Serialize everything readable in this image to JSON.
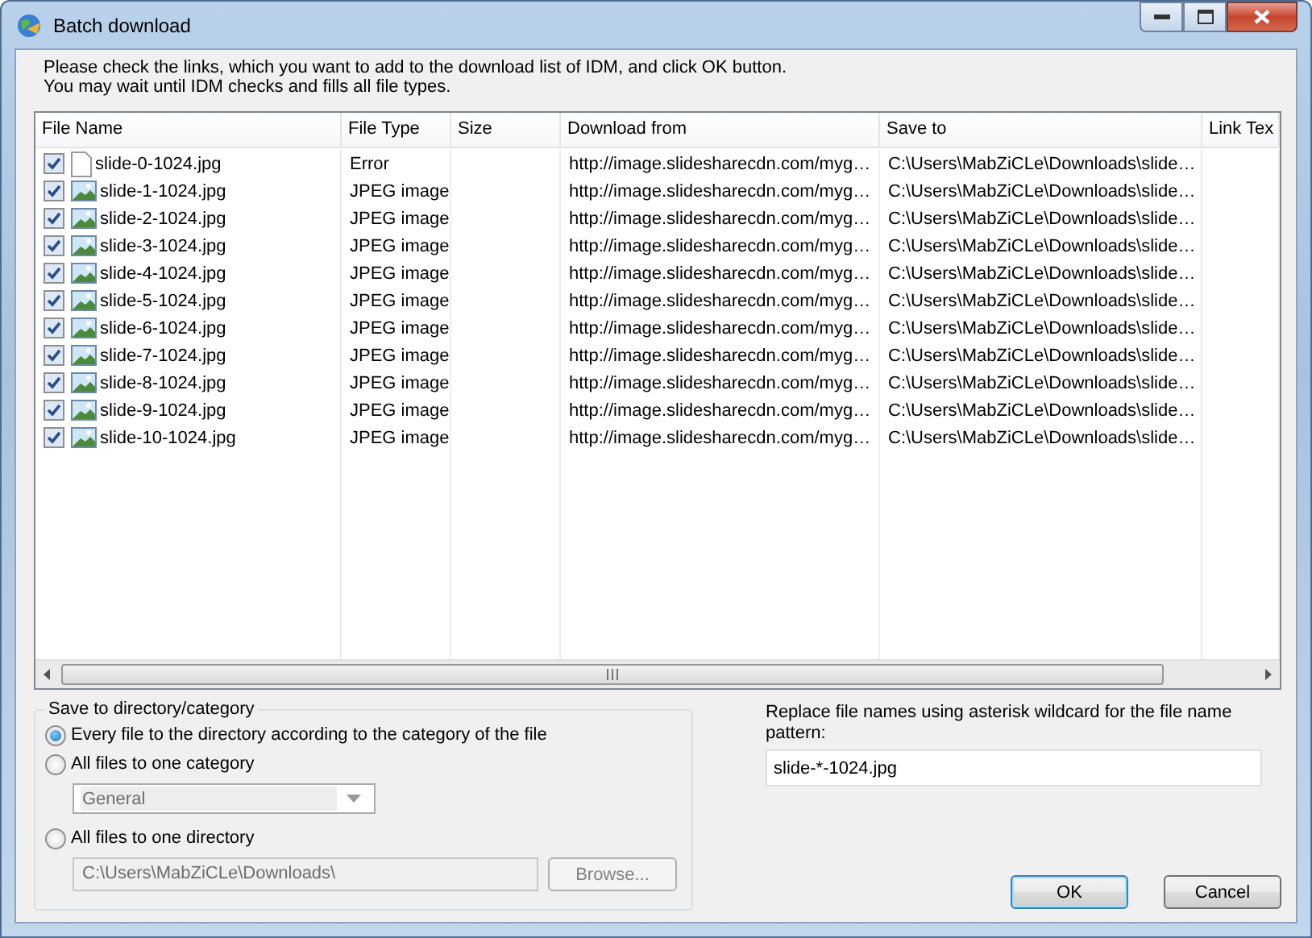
{
  "window": {
    "title": "Batch download"
  },
  "instructions": [
    "Please check the links, which you want to add to the download list of IDM, and click OK button.",
    "You may wait until IDM checks and fills all file types."
  ],
  "table": {
    "columns": [
      "File Name",
      "File Type",
      "Size",
      "Download from",
      "Save to",
      "Link Tex"
    ],
    "rows": [
      {
        "kind": "error",
        "checked": true,
        "name": "slide-0-1024.jpg",
        "type": "Error",
        "from": "http://image.slidesharecdn.com/myg…",
        "to": "C:\\Users\\MabZiCLe\\Downloads\\slide…"
      },
      {
        "kind": "image",
        "checked": true,
        "name": "slide-1-1024.jpg",
        "type": "JPEG image",
        "from": "http://image.slidesharecdn.com/myg…",
        "to": "C:\\Users\\MabZiCLe\\Downloads\\slide…"
      },
      {
        "kind": "image",
        "checked": true,
        "name": "slide-2-1024.jpg",
        "type": "JPEG image",
        "from": "http://image.slidesharecdn.com/myg…",
        "to": "C:\\Users\\MabZiCLe\\Downloads\\slide…"
      },
      {
        "kind": "image",
        "checked": true,
        "name": "slide-3-1024.jpg",
        "type": "JPEG image",
        "from": "http://image.slidesharecdn.com/myg…",
        "to": "C:\\Users\\MabZiCLe\\Downloads\\slide…"
      },
      {
        "kind": "image",
        "checked": true,
        "name": "slide-4-1024.jpg",
        "type": "JPEG image",
        "from": "http://image.slidesharecdn.com/myg…",
        "to": "C:\\Users\\MabZiCLe\\Downloads\\slide…"
      },
      {
        "kind": "image",
        "checked": true,
        "name": "slide-5-1024.jpg",
        "type": "JPEG image",
        "from": "http://image.slidesharecdn.com/myg…",
        "to": "C:\\Users\\MabZiCLe\\Downloads\\slide…"
      },
      {
        "kind": "image",
        "checked": true,
        "name": "slide-6-1024.jpg",
        "type": "JPEG image",
        "from": "http://image.slidesharecdn.com/myg…",
        "to": "C:\\Users\\MabZiCLe\\Downloads\\slide…"
      },
      {
        "kind": "image",
        "checked": true,
        "name": "slide-7-1024.jpg",
        "type": "JPEG image",
        "from": "http://image.slidesharecdn.com/myg…",
        "to": "C:\\Users\\MabZiCLe\\Downloads\\slide…"
      },
      {
        "kind": "image",
        "checked": true,
        "name": "slide-8-1024.jpg",
        "type": "JPEG image",
        "from": "http://image.slidesharecdn.com/myg…",
        "to": "C:\\Users\\MabZiCLe\\Downloads\\slide…"
      },
      {
        "kind": "image",
        "checked": true,
        "name": "slide-9-1024.jpg",
        "type": "JPEG image",
        "from": "http://image.slidesharecdn.com/myg…",
        "to": "C:\\Users\\MabZiCLe\\Downloads\\slide…"
      },
      {
        "kind": "image",
        "checked": true,
        "name": "slide-10-1024.jpg",
        "type": "JPEG image",
        "from": "http://image.slidesharecdn.com/myg…",
        "to": "C:\\Users\\MabZiCLe\\Downloads\\slide…"
      }
    ]
  },
  "save_group": {
    "title": "Save to directory/category",
    "options": [
      {
        "label": "Every file to the directory according to the category of the file",
        "selected": true
      },
      {
        "label": "All files to one category",
        "selected": false,
        "category": {
          "value": "General",
          "disabled": true
        }
      },
      {
        "label": "All files to one directory",
        "selected": false,
        "directory": {
          "value": "C:\\Users\\MabZiCLe\\Downloads\\",
          "disabled": true
        },
        "browse": {
          "label": "Browse...",
          "disabled": true
        }
      }
    ]
  },
  "rename": {
    "label": "Replace file names using asterisk wildcard for the file name pattern:",
    "value": "slide-*-1024.jpg"
  },
  "buttons": [
    {
      "label": "OK",
      "default": true
    },
    {
      "label": "Cancel",
      "default": false
    }
  ]
}
